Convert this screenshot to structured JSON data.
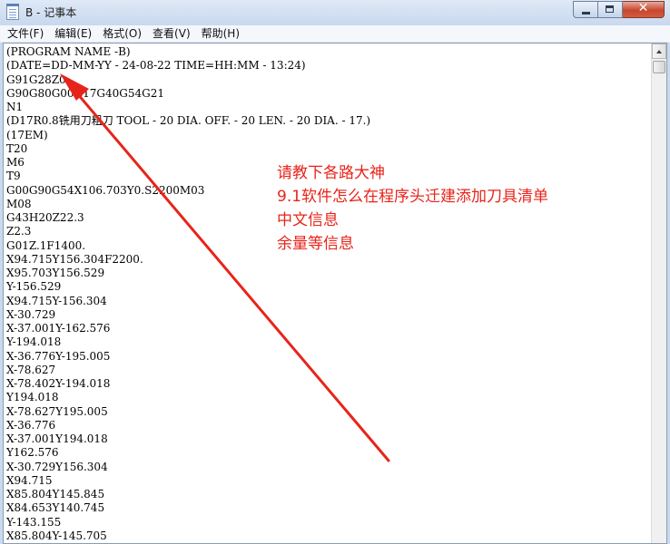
{
  "window": {
    "title": "B - 记事本",
    "controls": {
      "close_glyph": "✕"
    }
  },
  "menu": [
    {
      "label": "文件(F)"
    },
    {
      "label": "编辑(E)"
    },
    {
      "label": "格式(O)"
    },
    {
      "label": "查看(V)"
    },
    {
      "label": "帮助(H)"
    }
  ],
  "document": {
    "lines": [
      "(PROGRAM NAME -B)",
      "(DATE=DD-MM-YY - 24-08-22 TIME=HH:MM - 13:24)",
      "G91G28Z0.",
      "G90G80G00G17G40G54G21",
      "N1",
      "(D17R0.8铣用刀粗刀 TOOL - 20 DIA. OFF. - 20 LEN. - 20 DIA. - 17.)",
      "(17EM)",
      "T20",
      "M6",
      "T9",
      "G00G90G54X106.703Y0.S2200M03",
      "M08",
      "G43H20Z22.3",
      "Z2.3",
      "G01Z.1F1400.",
      "X94.715Y156.304F2200.",
      "X95.703Y156.529",
      "Y-156.529",
      "X94.715Y-156.304",
      "X-30.729",
      "X-37.001Y-162.576",
      "Y-194.018",
      "X-36.776Y-195.005",
      "X-78.627",
      "X-78.402Y-194.018",
      "Y194.018",
      "X-78.627Y195.005",
      "X-36.776",
      "X-37.001Y194.018",
      "Y162.576",
      "X-30.729Y156.304",
      "X94.715",
      "X85.804Y145.845",
      "X84.653Y140.745",
      "Y-143.155",
      "X85.804Y-145.705"
    ]
  },
  "annotation": {
    "color": "#e8241a",
    "lines": [
      "请教下各路大神",
      "9.1软件怎么在程序头迁建添加刀具清单",
      "中文信息",
      "余量等信息"
    ]
  }
}
